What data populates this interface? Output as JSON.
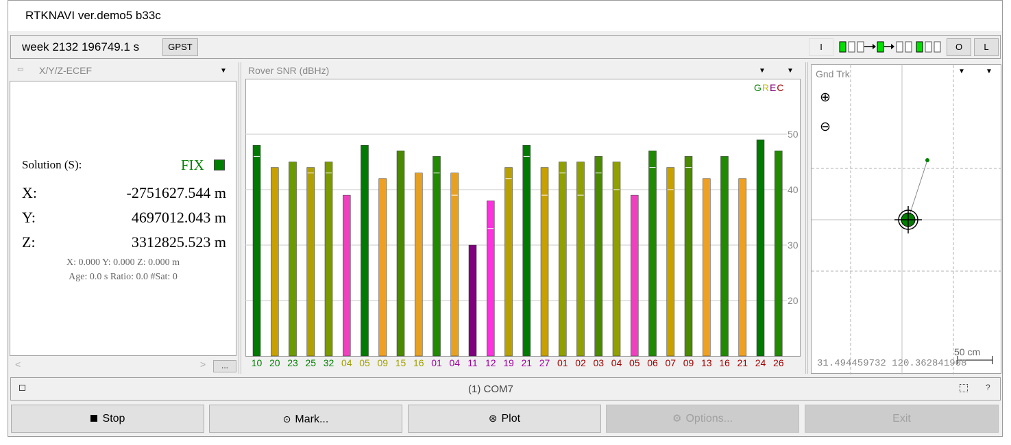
{
  "window": {
    "title": "RTKNAVI ver.demo5 b33c"
  },
  "status_bar": {
    "time": "week 2132 196749.1 s",
    "time_system": "GPST",
    "input_label": "I",
    "output_label": "O",
    "log_label": "L"
  },
  "solution_panel": {
    "header": "X/Y/Z-ECEF",
    "solution_label": "Solution (S):",
    "status": "FIX",
    "x_label": "X:",
    "x_value": "-2751627.544 m",
    "y_label": "Y:",
    "y_value": "4697012.043 m",
    "z_label": "Z:",
    "z_value": "3312825.523 m",
    "std_line": "X: 0.000 Y: 0.000 Z: 0.000 m",
    "age_line": "Age: 0.0 s Ratio: 0.0 #Sat: 0",
    "more_button": "..."
  },
  "snr_panel": {
    "header": "Rover  SNR (dBHz)",
    "legend": [
      "G",
      "R",
      "E",
      "C"
    ],
    "legend_colors": [
      "#008000",
      "#c0c000",
      "#800080",
      "#a00000"
    ]
  },
  "chart_data": {
    "type": "bar",
    "title": "Rover  SNR (dBHz)",
    "ylim": [
      10,
      50
    ],
    "yticks": [
      "50",
      "40",
      "30",
      "20"
    ],
    "categories": [
      "10",
      "20",
      "23",
      "25",
      "32",
      "04",
      "05",
      "09",
      "15",
      "16",
      "01",
      "04",
      "11",
      "12",
      "19",
      "21",
      "27",
      "01",
      "02",
      "03",
      "04",
      "05",
      "06",
      "07",
      "09",
      "13",
      "16",
      "21",
      "24",
      "26"
    ],
    "values": [
      48,
      44,
      45,
      44,
      45,
      39,
      48,
      42,
      47,
      43,
      46,
      43,
      30,
      38,
      44,
      48,
      44,
      45,
      45,
      46,
      45,
      39,
      47,
      44,
      46,
      42,
      46,
      42,
      49,
      47
    ],
    "marks": [
      46,
      null,
      null,
      43,
      43,
      null,
      null,
      null,
      null,
      null,
      43,
      39,
      null,
      33,
      42,
      46,
      39,
      43,
      39,
      43,
      40,
      null,
      44,
      40,
      44,
      null,
      null,
      null,
      null,
      null
    ],
    "bar_colors": [
      "#007a00",
      "#c8a000",
      "#6a9a00",
      "#b0a000",
      "#7a9a00",
      "#f040c0",
      "#007a00",
      "#f0a020",
      "#4a8a00",
      "#e8a020",
      "#208a00",
      "#e8a020",
      "#800080",
      "#ff30e0",
      "#b8a000",
      "#007a00",
      "#c8a000",
      "#90a000",
      "#90a000",
      "#4a8a00",
      "#90a000",
      "#f040c0",
      "#208a00",
      "#c8a000",
      "#4a8a00",
      "#f0a020",
      "#208a00",
      "#f0a020",
      "#007a00",
      "#208a00"
    ],
    "label_colors": [
      "#008000",
      "#008000",
      "#008000",
      "#008000",
      "#008000",
      "#a0a000",
      "#a0a000",
      "#a0a000",
      "#a0a000",
      "#a0a000",
      "#a000a0",
      "#a000a0",
      "#a000a0",
      "#a000a0",
      "#a000a0",
      "#a000a0",
      "#a000a0",
      "#a00000",
      "#a00000",
      "#a00000",
      "#a00000",
      "#a00000",
      "#a00000",
      "#a00000",
      "#a00000",
      "#a00000",
      "#a00000",
      "#a00000",
      "#a00000",
      "#a00000"
    ]
  },
  "track_panel": {
    "header": "Gnd Trk",
    "coords": "31.494459732 120.362841908",
    "scale": "50 cm"
  },
  "stream_bar": {
    "port": "(1) COM7",
    "help": "?"
  },
  "buttons": {
    "stop": "Stop",
    "mark": "Mark...",
    "plot": "Plot",
    "options": "Options...",
    "exit": "Exit"
  }
}
